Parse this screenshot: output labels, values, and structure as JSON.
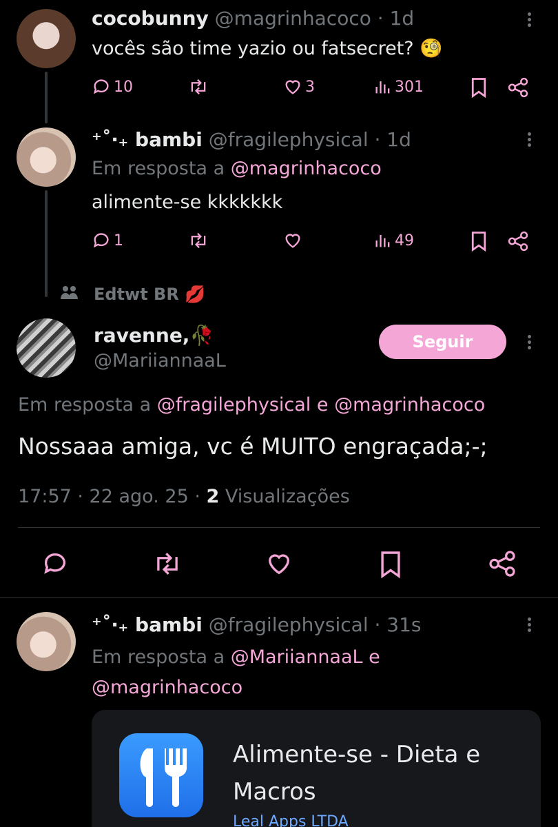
{
  "tweets": [
    {
      "display_name": "cocobunny",
      "handle": "@magrinhacoco",
      "time": "· 1d",
      "text": "vocês são time yazio ou fatsecret? 🧐",
      "replies": "10",
      "likes": "3",
      "views": "301"
    },
    {
      "display_name": "⁺˚‧₊ bambi",
      "handle": "@fragilephysical",
      "time": "· 1d",
      "reply_prefix": "Em resposta a",
      "reply_to": "@magrinhacoco",
      "text": "alimente-se kkkkkkk",
      "replies": "1",
      "views": "49"
    }
  ],
  "community_label": "Edtwt BR 💋",
  "focused_tweet": {
    "display_name": "ravenne,🥀",
    "handle": "@MariiannaaL",
    "follow_label": "Seguir",
    "reply_prefix": "Em resposta a",
    "reply_to_1": "@fragilephysical",
    "reply_conjunction": "e",
    "reply_to_2": "@magrinhacoco",
    "text": "Nossaaa amiga, vc é MUITO engraçada;-;",
    "time": "17:57 · 22 ago. 25 ·",
    "views_count": "2",
    "views_label": "Visualizações"
  },
  "reply_tweet": {
    "display_name": "⁺˚‧₊ bambi",
    "handle": "@fragilephysical",
    "time": "· 31s",
    "reply_prefix": "Em resposta a",
    "reply_to_1": "@MariiannaaL",
    "reply_conjunction": "e",
    "reply_to_2": "@magrinhacoco",
    "card": {
      "title": "Alimente-se - Dieta e Macros",
      "developer": "Leal Apps LTDA"
    }
  },
  "colors": {
    "accent": "#f4a6d7",
    "background": "#000000",
    "muted": "#71767b"
  }
}
